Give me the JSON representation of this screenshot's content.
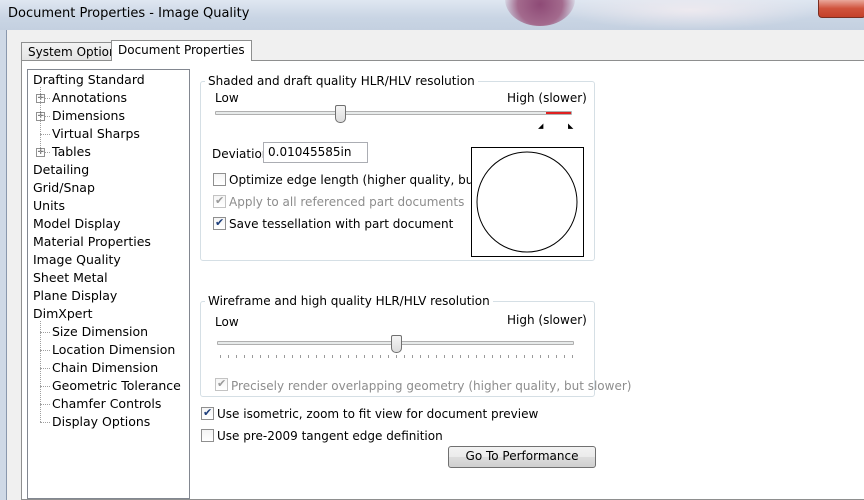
{
  "window": {
    "title": "Document Properties - Image Quality"
  },
  "tabs": [
    {
      "label": "System Options",
      "active": false
    },
    {
      "label": "Document Properties",
      "active": true
    }
  ],
  "tree": {
    "items": [
      {
        "label": "Drafting Standard",
        "level": 0
      },
      {
        "label": "Annotations",
        "level": 1,
        "expander": "+"
      },
      {
        "label": "Dimensions",
        "level": 1,
        "expander": "+"
      },
      {
        "label": "Virtual Sharps",
        "level": 1
      },
      {
        "label": "Tables",
        "level": 1,
        "expander": "+"
      },
      {
        "label": "Detailing",
        "level": 0
      },
      {
        "label": "Grid/Snap",
        "level": 0
      },
      {
        "label": "Units",
        "level": 0
      },
      {
        "label": "Model Display",
        "level": 0
      },
      {
        "label": "Material Properties",
        "level": 0
      },
      {
        "label": "Image Quality",
        "level": 0,
        "selected": true
      },
      {
        "label": "Sheet Metal",
        "level": 0
      },
      {
        "label": "Plane Display",
        "level": 0
      },
      {
        "label": "DimXpert",
        "level": 0
      },
      {
        "label": "Size Dimension",
        "level": 1
      },
      {
        "label": "Location Dimension",
        "level": 1
      },
      {
        "label": "Chain Dimension",
        "level": 1
      },
      {
        "label": "Geometric Tolerance",
        "level": 1
      },
      {
        "label": "Chamfer Controls",
        "level": 1
      },
      {
        "label": "Display Options",
        "level": 1
      }
    ]
  },
  "shaded": {
    "title": "Shaded and draft quality HLR/HLV resolution",
    "low_label": "Low",
    "high_label": "High (slower)",
    "slider_value": 0.35,
    "slider_red_from": 0.93,
    "deviation_label": "Deviation:",
    "deviation_value": "0.01045585in",
    "optimize_label": "Optimize edge length (higher quality, but slower)",
    "optimize_checked": false,
    "apply_all_label": "Apply to all referenced part documents",
    "apply_all_checked": true,
    "apply_all_disabled": true,
    "save_tess_label": "Save tessellation with part document",
    "save_tess_checked": true
  },
  "wireframe": {
    "title": "Wireframe and high quality HLR/HLV resolution",
    "low_label": "Low",
    "high_label": "High (slower)",
    "slider_value": 0.5,
    "precise_label": "Precisely render overlapping geometry (higher quality, but slower)",
    "precise_checked": true,
    "precise_disabled": true
  },
  "options": {
    "isometric_label": "Use isometric, zoom to fit view for document preview",
    "isometric_checked": true,
    "pre2009_label": "Use pre-2009 tangent edge definition",
    "pre2009_checked": false
  },
  "performance_button": "Go To Performance",
  "colors": {
    "slider_red": "#e02020",
    "selection": "#000000"
  }
}
